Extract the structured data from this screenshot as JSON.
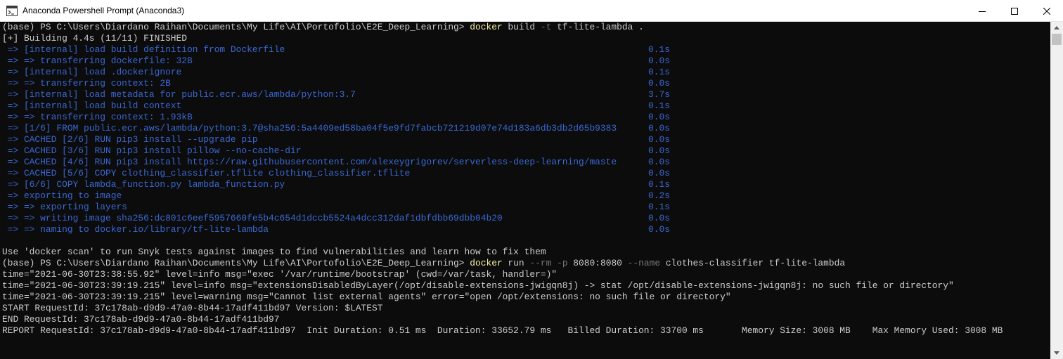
{
  "window": {
    "title": "Anaconda Powershell Prompt (Anaconda3)",
    "controls": {
      "minimize_icon": "minimize-icon",
      "maximize_icon": "maximize-icon",
      "close_icon": "close-icon"
    }
  },
  "colors": {
    "background": "#0c0c0c",
    "text": "#cccccc",
    "build_step": "#3a67d2",
    "command": "#f9f1a5",
    "flag": "#767676"
  },
  "console": {
    "prompt1": {
      "prompt": "(base) PS C:\\Users\\Diardano Raihan\\Documents\\My Life\\AI\\Portofolio\\E2E_Deep_Learning> ",
      "cmd": "docker",
      "args1": " build ",
      "flag1": "-t",
      "args2": " tf-lite-lambda ."
    },
    "building": "[+] Building 4.4s (11/11) FINISHED",
    "steps": [
      {
        "text": " => [internal] load build definition from Dockerfile",
        "time": "0.1s"
      },
      {
        "text": " => => transferring dockerfile: 32B",
        "time": "0.0s"
      },
      {
        "text": " => [internal] load .dockerignore",
        "time": "0.1s"
      },
      {
        "text": " => => transferring context: 2B",
        "time": "0.0s"
      },
      {
        "text": " => [internal] load metadata for public.ecr.aws/lambda/python:3.7",
        "time": "3.7s"
      },
      {
        "text": " => [internal] load build context",
        "time": "0.1s"
      },
      {
        "text": " => => transferring context: 1.93kB",
        "time": "0.0s"
      },
      {
        "text": " => [1/6] FROM public.ecr.aws/lambda/python:3.7@sha256:5a4409ed58ba04f5e9fd7fabcb721219d07e74d183a6db3db2d65b9383",
        "time": "0.0s"
      },
      {
        "text": " => CACHED [2/6] RUN pip3 install --upgrade pip",
        "time": "0.0s"
      },
      {
        "text": " => CACHED [3/6] RUN pip3 install pillow --no-cache-dir",
        "time": "0.0s"
      },
      {
        "text": " => CACHED [4/6] RUN pip3 install https://raw.githubusercontent.com/alexeygrigorev/serverless-deep-learning/maste",
        "time": "0.0s"
      },
      {
        "text": " => CACHED [5/6] COPY clothing_classifier.tflite clothing_classifier.tflite",
        "time": "0.0s"
      },
      {
        "text": " => [6/6] COPY lambda_function.py lambda_function.py",
        "time": "0.1s"
      },
      {
        "text": " => exporting to image",
        "time": "0.2s"
      },
      {
        "text": " => => exporting layers",
        "time": "0.1s"
      },
      {
        "text": " => => writing image sha256:dc801c6eef5957660fe5b4c654d1dccb5524a4dcc312daf1dbfdbb69dbb04b20",
        "time": "0.0s"
      },
      {
        "text": " => => naming to docker.io/library/tf-lite-lambda",
        "time": "0.0s"
      }
    ],
    "scan_hint": "Use 'docker scan' to run Snyk tests against images to find vulnerabilities and learn how to fix them",
    "prompt2": {
      "prompt": "(base) PS C:\\Users\\Diardano Raihan\\Documents\\My Life\\AI\\Portofolio\\E2E_Deep_Learning> ",
      "cmd": "docker",
      "args1": " run ",
      "flag1": "--rm",
      "args2": " ",
      "flag2": "-p",
      "args3": " 8080:8080 ",
      "flag3": "--name",
      "args4": " clothes-classifier tf-lite-lambda"
    },
    "logs": [
      "time=\"2021-06-30T23:38:55.92\" level=info msg=\"exec '/var/runtime/bootstrap' (cwd=/var/task, handler=)\"",
      "time=\"2021-06-30T23:39:19.215\" level=info msg=\"extensionsDisabledByLayer(/opt/disable-extensions-jwigqn8j) -> stat /opt/disable-extensions-jwigqn8j: no such file or directory\"",
      "time=\"2021-06-30T23:39:19.215\" level=warning msg=\"Cannot list external agents\" error=\"open /opt/extensions: no such file or directory\"",
      "START RequestId: 37c178ab-d9d9-47a0-8b44-17adf411bd97 Version: $LATEST",
      "END RequestId: 37c178ab-d9d9-47a0-8b44-17adf411bd97",
      "REPORT RequestId: 37c178ab-d9d9-47a0-8b44-17adf411bd97  Init Duration: 0.51 ms  Duration: 33652.79 ms   Billed Duration: 33700 ms       Memory Size: 3008 MB    Max Memory Used: 3008 MB"
    ]
  }
}
